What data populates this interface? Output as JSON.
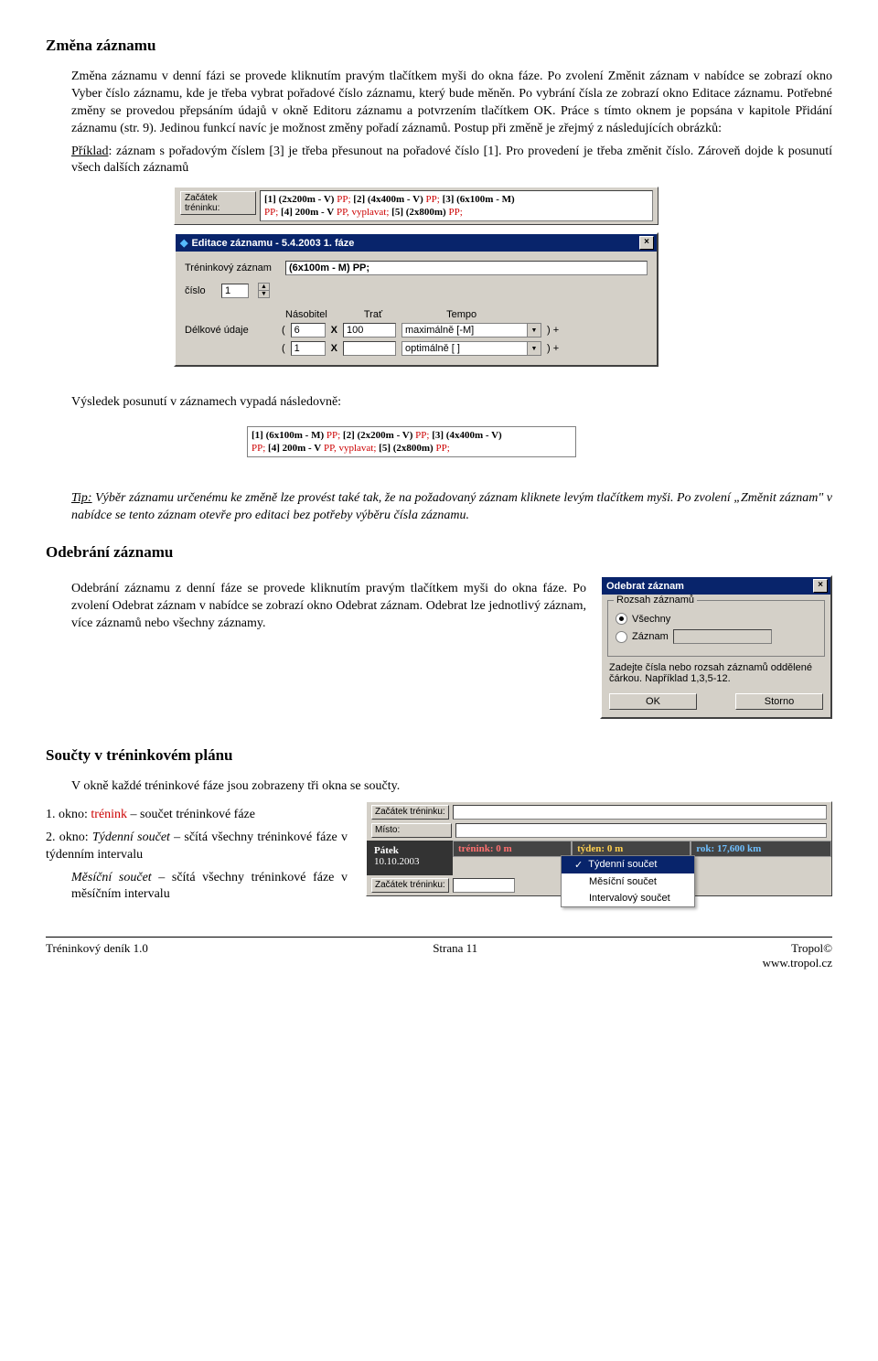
{
  "title1": "Změna záznamu",
  "para1": "Změna záznamu v denní fázi se provede kliknutím pravým tlačítkem myši do okna fáze. Po zvolení Změnit záznam v nabídce se zobrazí okno Vyber číslo záznamu, kde je třeba vybrat pořadové číslo záznamu, který bude měněn. Po vybrání čísla ze zobrazí okno Editace záznamu. Potřebné změny se provedou přepsáním údajů v okně Editoru záznamu a potvrzením tlačítkem OK. Práce s tímto oknem je popsána v kapitole Přidání záznamu (str. 9). Jedinou funkcí navíc je možnost změny pořadí záznamů. Postup při změně je zřejmý z následujících obrázků:",
  "para2_pre": "Příklad",
  "para2": ": záznam s pořadovým číslem [3] je třeba přesunout na pořadové číslo [1]. Pro provedení je třeba změnit číslo. Zároveň dojde k posunutí všech dalších záznamů",
  "screenshot1": {
    "zacatek_label": "Začátek tréninku:",
    "plan_line1a": "[1] (2x200m - V)",
    "pp": " PP; ",
    "plan_line1b": "[2] (4x400m - V)",
    "plan_line1c": "[3] (6x100m - M)",
    "plan_line2a": "[4] 200m - V",
    "plan_line2b": " PP, vyplavat; ",
    "plan_line2c": "[5] (2x800m)",
    "editor_title": "Editace záznamu - 5.4.2003 1. fáze",
    "label_tren": "Tréninkový záznam",
    "val_tren": "(6x100m - M) PP;",
    "label_cislo": "číslo",
    "val_cislo": "1",
    "label_delkove": "Délkové údaje",
    "col_nasobitel": "Násobitel",
    "col_trat": "Trať",
    "col_tempo": "Tempo",
    "r1_a": "6",
    "r1_b": "100",
    "r1_c": "maximálně [-M]",
    "r2_a": "1",
    "r2_c": "optimálně [ ]"
  },
  "para3": "Výsledek posunutí v záznamech vypadá následovně:",
  "screenshot2": {
    "line1a": "[1] (6x100m - M)",
    "line1b": "[2] (2x200m - V)",
    "line1c": "[3] (4x400m - V)",
    "line2a": "[4] 200m - V",
    "line2b": " PP, vyplavat; ",
    "line2c": "[5] (2x800m)"
  },
  "tip_pre": "Tip:",
  "tip": " Výběr záznamu určenému ke změně lze provést také tak, že na požadovaný záznam kliknete levým tlačítkem myši. Po zvolení „Změnit záznam\" v nabídce se tento záznam otevře pro editaci bez potřeby výběru čísla záznamu.",
  "title2": "Odebrání záznamu",
  "para4": "Odebrání záznamu z denní fáze se provede kliknutím pravým tlačítkem myši do okna fáze. Po zvolení Odebrat záznam v nabídce se zobrazí okno Odebrat záznam. Odebrat lze jednotlivý záznam, více záznamů nebo všechny záznamy.",
  "dialog_remove": {
    "title": "Odebrat záznam",
    "group": "Rozsah záznamů",
    "opt1": "Všechny",
    "opt2": "Záznam",
    "hint": "Zadejte čísla nebo rozsah záznamů oddělené čárkou. Například 1,3,5-12.",
    "ok": "OK",
    "storno": "Storno"
  },
  "title3": "Součty v tréninkovém plánu",
  "para5": "V okně každé tréninkové fáze jsou zobrazeny tři okna se součty.",
  "item1a": "1. okno: ",
  "item1b": "trénink",
  "item1c": " – součet tréninkové fáze",
  "item2a": "2. okno: ",
  "item2b": "Týdenní součet",
  "item2c": " – sčítá všechny tréninkové fáze v týdenním intervalu",
  "item3b": "Měsíční součet",
  "item3c": " – sčítá všechny tréninkové fáze v měsíčním intervalu",
  "screenshot3": {
    "zacatek": "Začátek tréninku:",
    "misto": "Místo:",
    "den": "Pátek",
    "datum": "10.10.2003",
    "t_label": "trénink: 0 m",
    "ty_label": "týden: 0 m",
    "rok_label": "rok: 17,600 km",
    "menu1": "Týdenní součet",
    "menu2": "Měsíční součet",
    "menu3": "Intervalový součet"
  },
  "footer": {
    "left": "Tréninkový deník 1.0",
    "center": "Strana 11",
    "right1": "Tropol©",
    "right2": "www.tropol.cz"
  }
}
